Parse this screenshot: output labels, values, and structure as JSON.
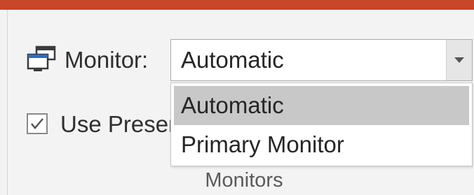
{
  "ribbon": {
    "accent_color": "#c8472a",
    "group_label": "Monitors"
  },
  "monitor": {
    "icon": "monitor-icon",
    "label": "Monitor:",
    "selected_value": "Automatic",
    "dropdown_icon": "chevron-down-icon",
    "options": [
      {
        "label": "Automatic",
        "highlighted": true
      },
      {
        "label": "Primary Monitor",
        "highlighted": false
      }
    ]
  },
  "presenter_view": {
    "checked": true,
    "label": "Use Presenter View"
  }
}
